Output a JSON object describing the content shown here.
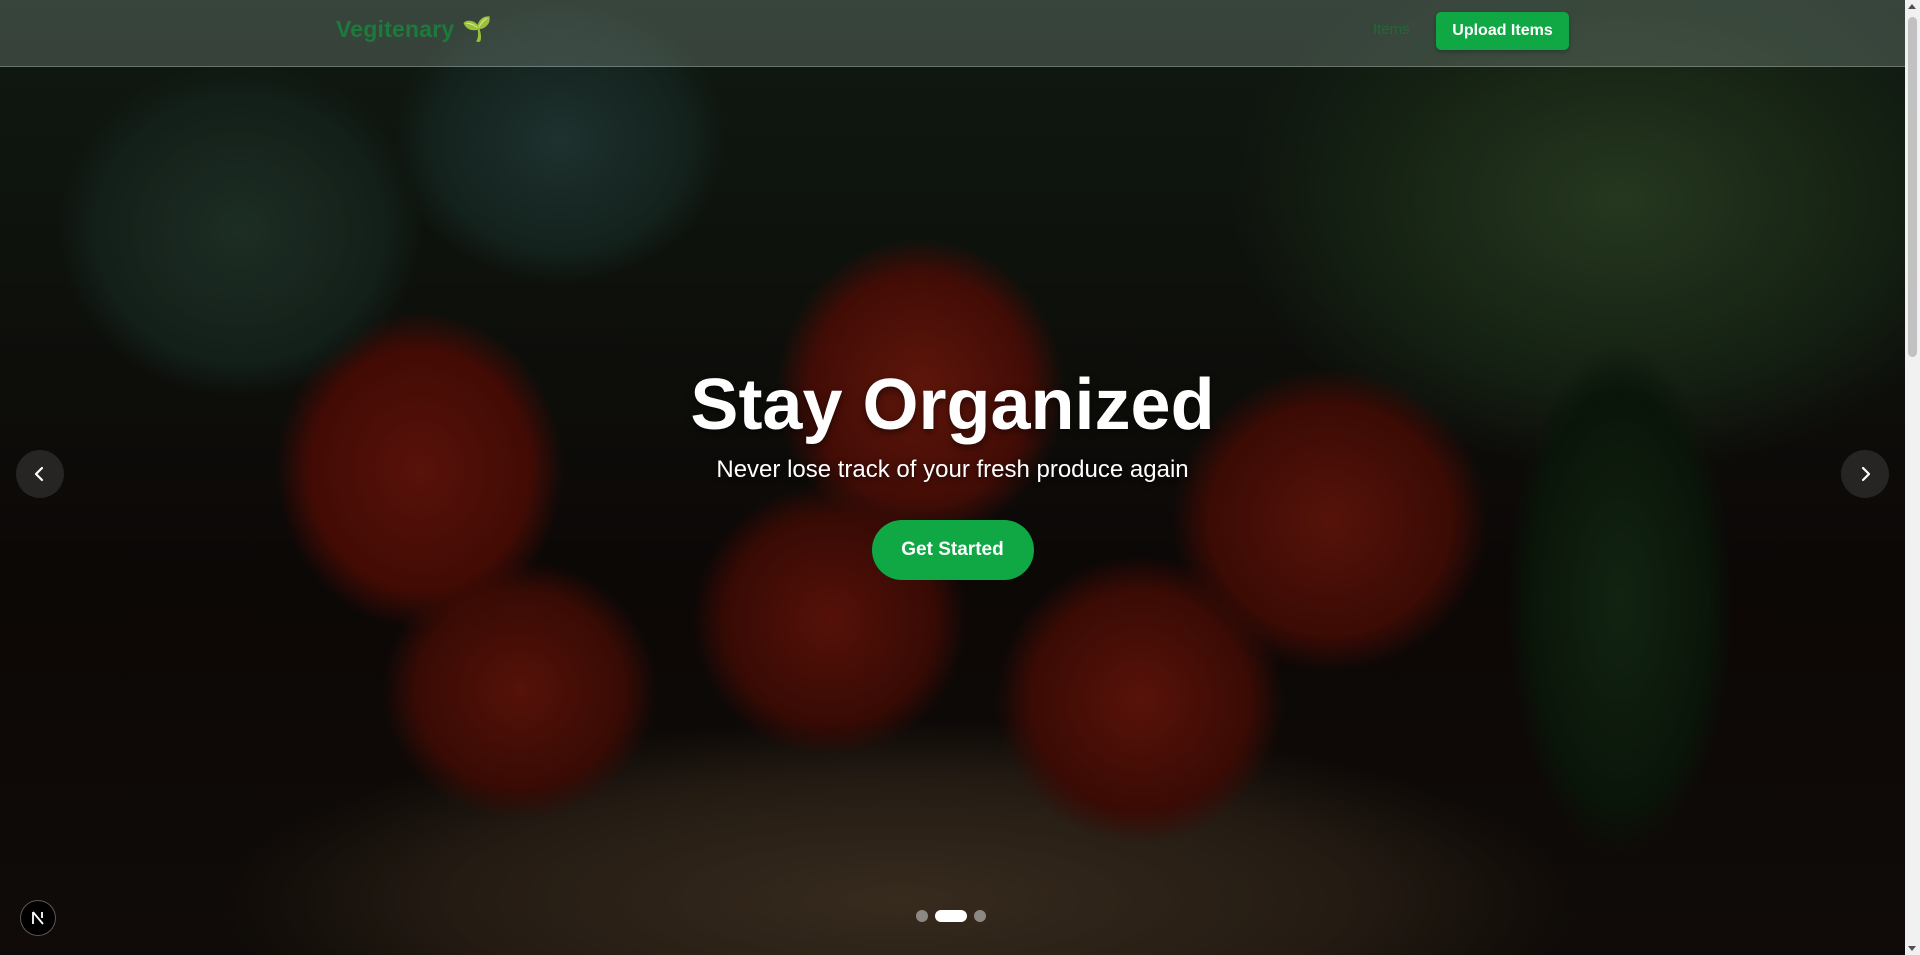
{
  "navbar": {
    "brand": "Vegitenary",
    "brand_emoji": "🌱",
    "links": [
      {
        "label": "Items"
      }
    ],
    "upload_button": "Upload Items"
  },
  "hero": {
    "title": "Stay Organized",
    "subtitle": "Never lose track of your fresh produce again",
    "cta": "Get Started"
  },
  "carousel": {
    "slide_count": 3,
    "active_index": 1,
    "prev_icon": "chevron-left-icon",
    "next_icon": "chevron-right-icon"
  },
  "badge": {
    "icon": "nextjs-logo-icon",
    "letter": "N"
  },
  "colors": {
    "accent": "#0fa845",
    "brand_text": "#1c7a3a",
    "nav_link": "#1d6b35"
  }
}
